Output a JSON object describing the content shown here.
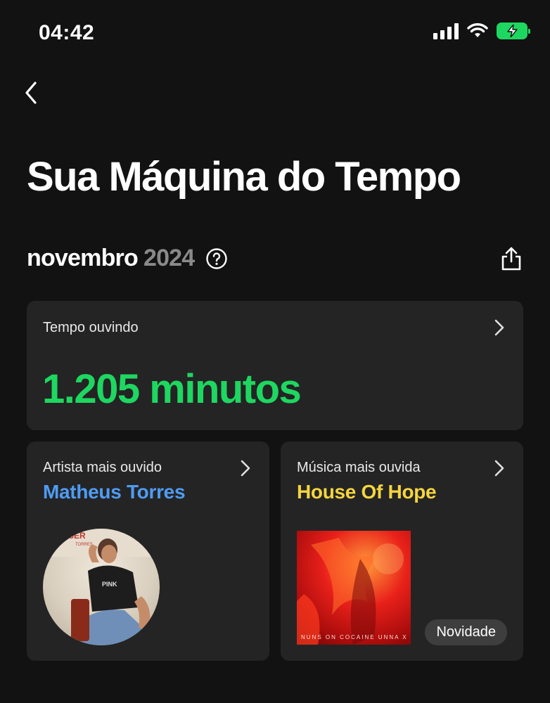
{
  "status_bar": {
    "time": "04:42"
  },
  "header": {
    "title": "Sua Máquina do Tempo"
  },
  "period": {
    "month": "novembro",
    "year": "2024"
  },
  "time_card": {
    "label": "Tempo ouvindo",
    "value": "1.205 minutos"
  },
  "artist_card": {
    "label": "Artista mais ouvido",
    "value": "Matheus Torres"
  },
  "song_card": {
    "label": "Música mais ouvida",
    "value": "House Of Hope",
    "album_text": "NUNS ON COCAINE UNNA X",
    "badge": "Novidade"
  },
  "colors": {
    "accent_green": "#1ed760",
    "artist_blue": "#4f9cf4",
    "song_yellow": "#f5d53f"
  },
  "icons": [
    "back-icon",
    "help-icon",
    "share-icon",
    "chevron-right-icon",
    "signal-icon",
    "wifi-icon",
    "battery-charging-icon"
  ]
}
